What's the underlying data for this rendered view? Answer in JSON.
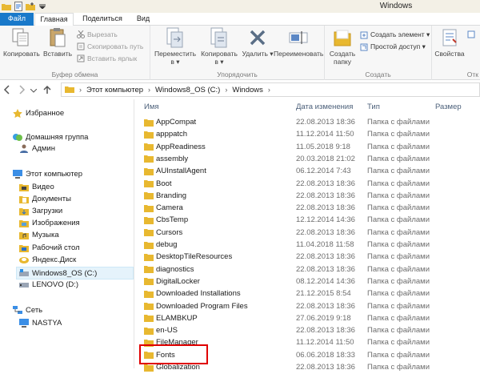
{
  "window": {
    "title": "Windows"
  },
  "tabs": {
    "file": "Файл",
    "home": "Главная",
    "share": "Поделиться",
    "view": "Вид"
  },
  "ribbon": {
    "clipboard": {
      "label": "Буфер обмена",
      "copy": "Копировать",
      "paste": "Вставить",
      "cut": "Вырезать",
      "copy_path": "Скопировать путь",
      "paste_shortcut": "Вставить ярлык"
    },
    "organize": {
      "label": "Упорядочить",
      "move_to": "Переместить",
      "move_to2": "в ▾",
      "copy_to": "Копировать",
      "copy_to2": "в ▾",
      "delete": "Удалить ▾",
      "rename": "Переименовать"
    },
    "create": {
      "label": "Создать",
      "new_folder": "Создать",
      "new_folder2": "папку",
      "new_item": "Создать элемент ▾",
      "easy_access": "Простой доступ ▾"
    },
    "open": {
      "properties": "Свойства",
      "open_label": "Отк"
    }
  },
  "address": {
    "crumbs": [
      "Этот компьютер",
      "Windows8_OS (C:)",
      "Windows"
    ]
  },
  "nav": {
    "favorites": "Избранное",
    "homegroup": "Домашняя группа",
    "admin": "Админ",
    "this_pc": "Этот компьютер",
    "video": "Видео",
    "documents": "Документы",
    "downloads": "Загрузки",
    "pictures": "Изображения",
    "music": "Музыка",
    "desktop": "Рабочий стол",
    "yadisk": "Яндекс.Диск",
    "drive_c": "Windows8_OS (C:)",
    "drive_d": "LENOVO (D:)",
    "network": "Сеть",
    "nastya": "NASTYA"
  },
  "columns": {
    "name": "Имя",
    "date": "Дата изменения",
    "type": "Тип",
    "size": "Размер"
  },
  "files": [
    {
      "name": "AppCompat",
      "date": "22.08.2013 18:36",
      "type": "Папка с файлами"
    },
    {
      "name": "apppatch",
      "date": "11.12.2014 11:50",
      "type": "Папка с файлами"
    },
    {
      "name": "AppReadiness",
      "date": "11.05.2018 9:18",
      "type": "Папка с файлами"
    },
    {
      "name": "assembly",
      "date": "20.03.2018 21:02",
      "type": "Папка с файлами"
    },
    {
      "name": "AUInstallAgent",
      "date": "06.12.2014 7:43",
      "type": "Папка с файлами"
    },
    {
      "name": "Boot",
      "date": "22.08.2013 18:36",
      "type": "Папка с файлами"
    },
    {
      "name": "Branding",
      "date": "22.08.2013 18:36",
      "type": "Папка с файлами"
    },
    {
      "name": "Camera",
      "date": "22.08.2013 18:36",
      "type": "Папка с файлами"
    },
    {
      "name": "CbsTemp",
      "date": "12.12.2014 14:36",
      "type": "Папка с файлами"
    },
    {
      "name": "Cursors",
      "date": "22.08.2013 18:36",
      "type": "Папка с файлами"
    },
    {
      "name": "debug",
      "date": "11.04.2018 11:58",
      "type": "Папка с файлами"
    },
    {
      "name": "DesktopTileResources",
      "date": "22.08.2013 18:36",
      "type": "Папка с файлами"
    },
    {
      "name": "diagnostics",
      "date": "22.08.2013 18:36",
      "type": "Папка с файлами"
    },
    {
      "name": "DigitalLocker",
      "date": "08.12.2014 14:36",
      "type": "Папка с файлами"
    },
    {
      "name": "Downloaded Installations",
      "date": "21.12.2015 8:54",
      "type": "Папка с файлами"
    },
    {
      "name": "Downloaded Program Files",
      "date": "22.08.2013 18:36",
      "type": "Папка с файлами"
    },
    {
      "name": "ELAMBKUP",
      "date": "27.06.2019 9:18",
      "type": "Папка с файлами"
    },
    {
      "name": "en-US",
      "date": "22.08.2013 18:36",
      "type": "Папка с файлами"
    },
    {
      "name": "FileManager",
      "date": "11.12.2014 11:50",
      "type": "Папка с файлами"
    },
    {
      "name": "Fonts",
      "date": "06.06.2018 18:33",
      "type": "Папка с файлами"
    },
    {
      "name": "Globalization",
      "date": "22.08.2013 18:36",
      "type": "Папка с файлами"
    }
  ],
  "colors": {
    "file_tab": "#1979ca",
    "folder": "#e8b830",
    "highlight": "#e00000",
    "selection": "#e5f3fb"
  }
}
